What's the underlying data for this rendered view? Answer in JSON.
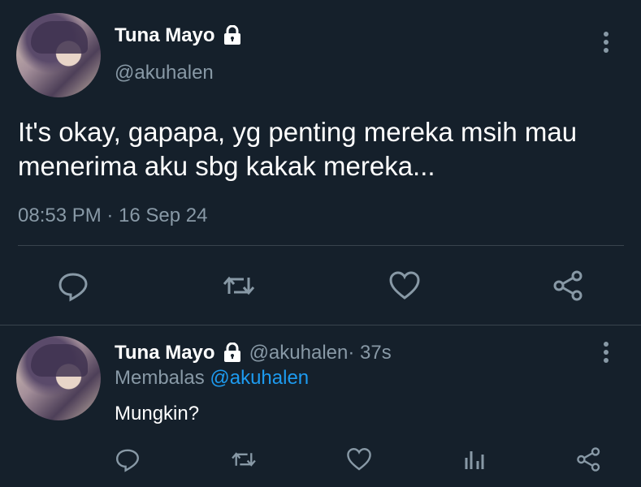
{
  "main_tweet": {
    "display_name": "Tuna Mayo",
    "handle": "@akuhalen",
    "text": "It's okay, gapapa, yg penting mereka msih mau menerima aku sbg kakak mereka...",
    "timestamp": "08:53 PM · 16 Sep 24"
  },
  "reply": {
    "display_name": "Tuna Mayo",
    "handle": "@akuhalen",
    "time": " · 37s",
    "replying_prefix": "Membalas ",
    "replying_mention": "@akuhalen",
    "text": "Mungkin?"
  },
  "icons": {
    "lock": "lock-icon",
    "more": "more-vertical-icon",
    "reply": "reply-icon",
    "retweet": "retweet-icon",
    "like": "heart-icon",
    "share": "share-icon",
    "analytics": "analytics-icon"
  },
  "colors": {
    "background": "#15202b",
    "text": "#ffffff",
    "secondary": "#8899a6",
    "accent": "#1d9bf0",
    "divider": "#38444d"
  }
}
